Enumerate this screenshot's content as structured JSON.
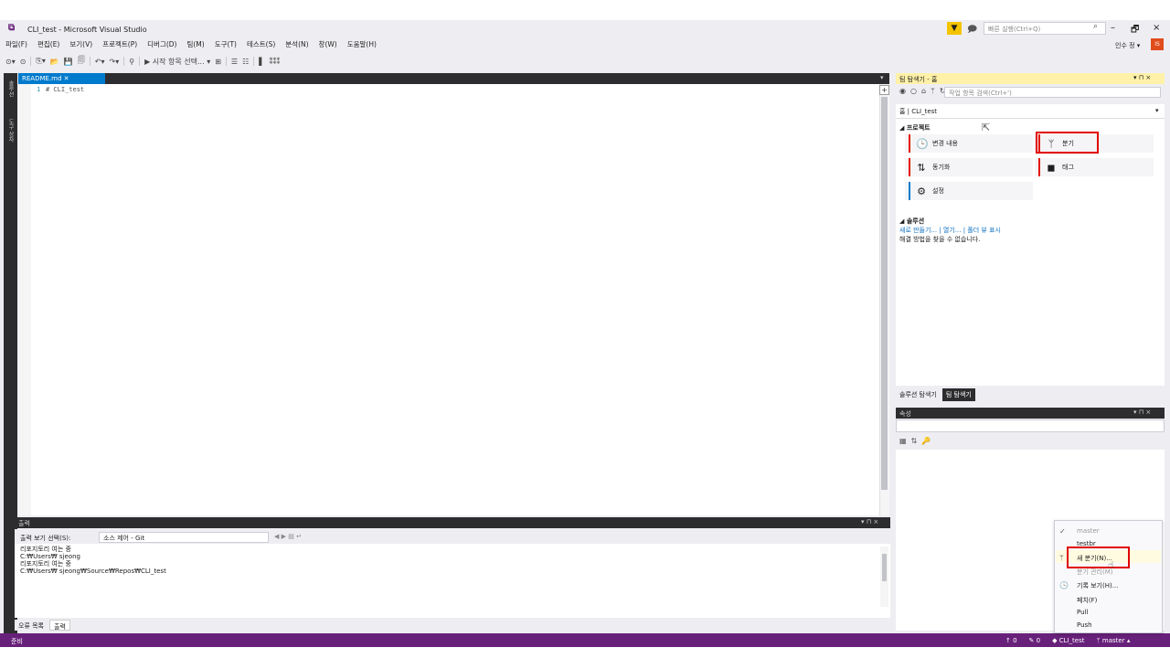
{
  "window": {
    "title": "CLI_test - Microsoft Visual Studio",
    "quick_launch_placeholder": "빠른 실행(Ctrl+Q)",
    "minimize": "–",
    "maximize": "🗗",
    "close": "×",
    "user_name": "인수 정 ▾",
    "user_initials": "IS"
  },
  "menu": [
    "파일(F)",
    "편집(E)",
    "보기(V)",
    "프로젝트(P)",
    "디버그(D)",
    "팀(M)",
    "도구(T)",
    "테스트(S)",
    "분석(N)",
    "창(W)",
    "도움말(H)"
  ],
  "toolbar": {
    "start_label": "▶ 시작 항목 선택... ▾"
  },
  "left_strip": {
    "item1": "솔루션",
    "item2": "도구 상자"
  },
  "editor": {
    "tab_label": "README.md  ✕",
    "line_number": "1",
    "line_text": "# CLI_test",
    "tab_ctrl": "▾"
  },
  "output": {
    "title": "출력",
    "title_ctrl": "▾ ⊓ ×",
    "show_label": "출력 보기 선택(S):",
    "source": "소스 제어 - Git",
    "lines": [
      "리포지토리 여는 중",
      "C:₩Users₩ sjeong",
      "리포지토리 여는 중",
      "C:₩Users₩ sjeong₩Source₩Repos₩CLI_test"
    ],
    "tab_errors": "오류 목록",
    "tab_output": "출력"
  },
  "status": {
    "ready": "준비",
    "push_count": "↑ 0",
    "changes": "✎ 0",
    "repo": "◆ CLI_test",
    "branch": "ᛘ master ▴"
  },
  "team_explorer": {
    "title": "팀 탐색기 - 홈",
    "title_ctrl": "▾ ⊓ ×",
    "search_placeholder": "작업 항목 검색(Ctrl+')",
    "home_label": "홈 | CLI_test",
    "project_section": "◢ 프로젝트",
    "tiles": {
      "changes": "변경 내용",
      "branches": "분기",
      "sync": "동기화",
      "tags": "태그",
      "settings": "설정"
    },
    "solutions_section": "◢ 솔루션",
    "solutions_links": "새로 만들기... | 열기... | 폴더 뷰 표시",
    "solutions_empty": "해결 방법을 찾을 수 없습니다.",
    "tab_solution_explorer": "솔루션 탐색기",
    "tab_team_explorer": "팀 탐색기"
  },
  "properties": {
    "title": "속성",
    "title_ctrl": "▾ ⊓ ×"
  },
  "branch_menu": {
    "items": [
      "master",
      "testbr",
      "새 분기(N)...",
      "분기 관리(M)",
      "기록 보기(H)...",
      "페치(F)",
      "Pull",
      "Push"
    ]
  },
  "colors": {
    "status_bar": "#68217a",
    "accent": "#007acc",
    "highlight_box": "#e00000"
  }
}
